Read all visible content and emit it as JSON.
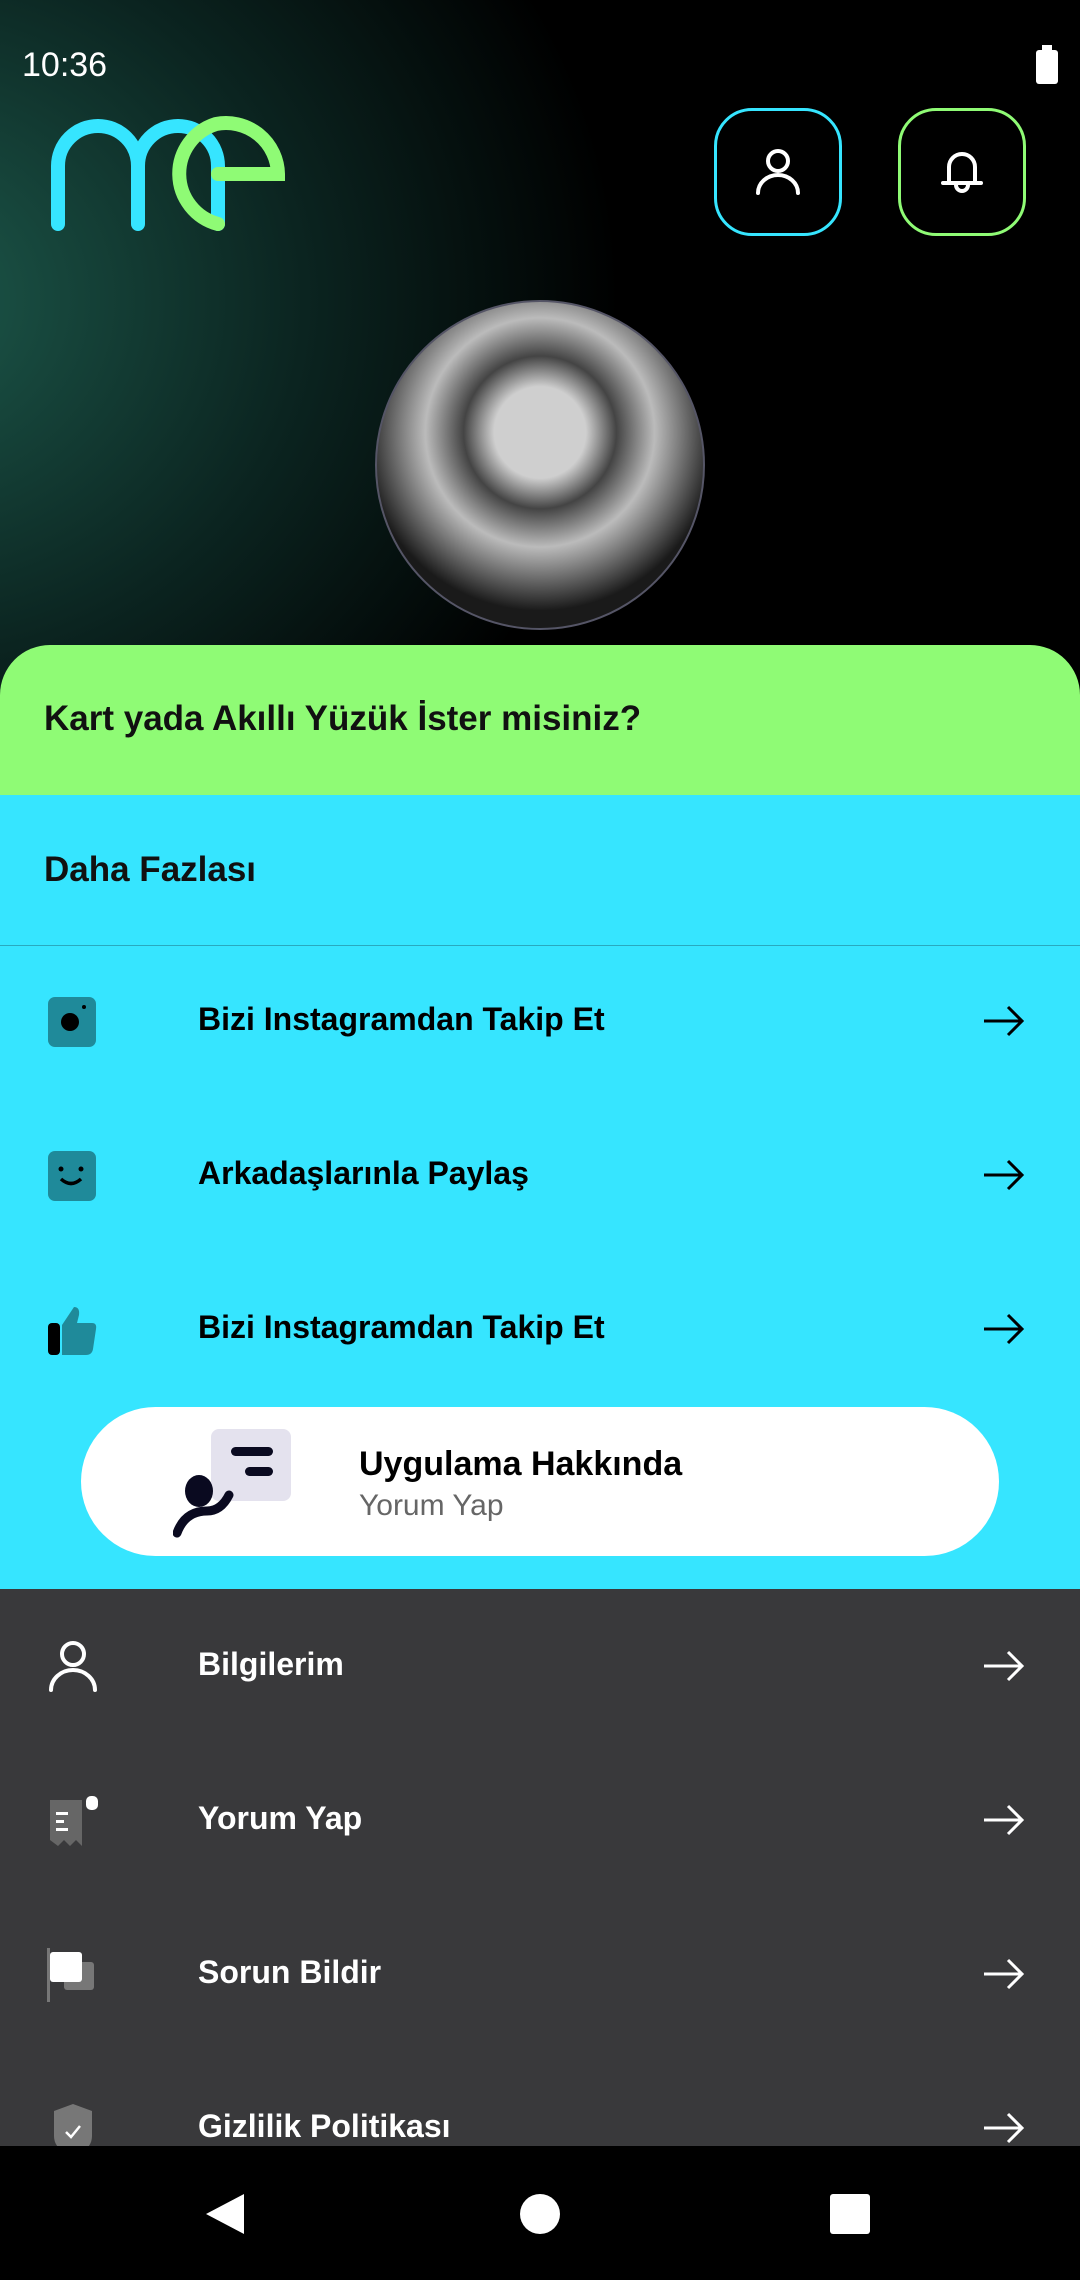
{
  "status": {
    "time": "10:36",
    "battery": "battery-full-icon"
  },
  "header": {
    "logo": "me",
    "profile_icon": "person-icon",
    "notification_icon": "bell-icon"
  },
  "colors": {
    "cyan": "#36e5ff",
    "green": "#8ffb75",
    "dark": "#39393b"
  },
  "banner": {
    "title": "Kart yada Akıllı Yüzük İster misiniz?"
  },
  "more": {
    "title": "Daha Fazlası",
    "items": [
      {
        "label": "Bizi Instagramdan Takip Et",
        "icon": "instagram-icon"
      },
      {
        "label": "Arkadaşlarınla Paylaş",
        "icon": "smile-icon"
      },
      {
        "label": "Bizi Instagramdan Takip Et",
        "icon": "thumbs-up-icon"
      }
    ],
    "card": {
      "title": "Uygulama Hakkında",
      "subtitle": "Yorum Yap"
    }
  },
  "settings": {
    "items": [
      {
        "label": "Bilgilerim",
        "icon": "person-icon"
      },
      {
        "label": "Yorum Yap",
        "icon": "receipt-icon"
      },
      {
        "label": "Sorun Bildir",
        "icon": "flag-icon"
      },
      {
        "label": "Gizlilik Politikası",
        "icon": "shield-check-icon"
      }
    ]
  }
}
